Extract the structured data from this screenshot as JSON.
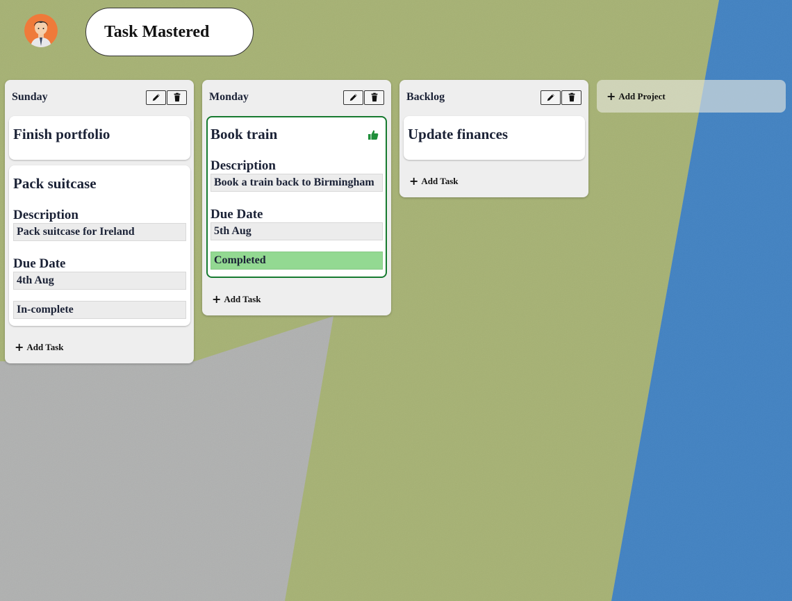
{
  "app": {
    "title": "Task Mastered"
  },
  "colors": {
    "grey_bg": "#c3c5c4",
    "green_bg": "#b5c66a",
    "blue_bg": "#1f7fde",
    "completed_border": "#167a2f",
    "completed_fill": "#93d992",
    "column_bg": "#eeeeee"
  },
  "icons": {
    "edit": "pencil-icon",
    "delete": "trash-icon",
    "completed": "thumbs-up-icon",
    "add": "plus-icon",
    "avatar": "user-avatar"
  },
  "labels": {
    "add_task": "Add Task",
    "add_project": "Add Project",
    "description": "Description",
    "due_date": "Due Date"
  },
  "columns": [
    {
      "title": "Sunday",
      "tasks": [
        {
          "title": "Finish portfolio"
        },
        {
          "title": "Pack suitcase",
          "description": "Pack suitcase for Ireland",
          "due": "4th Aug",
          "status": "In-complete"
        }
      ]
    },
    {
      "title": "Monday",
      "tasks": [
        {
          "title": "Book train",
          "description": "Book a train back to Birmingham",
          "due": "5th Aug",
          "status": "Completed"
        }
      ]
    },
    {
      "title": "Backlog",
      "tasks": [
        {
          "title": "Update finances"
        }
      ]
    }
  ]
}
